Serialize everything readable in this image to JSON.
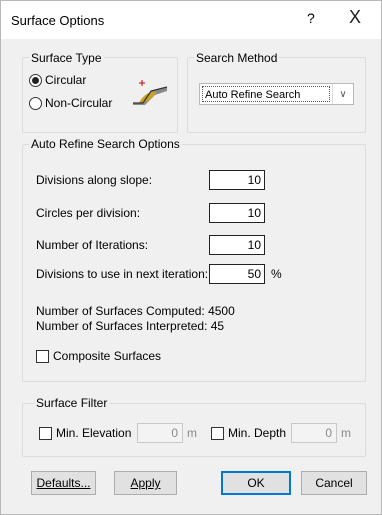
{
  "window": {
    "title": "Surface Options",
    "help_label": "?",
    "close_label": "X"
  },
  "surface_type": {
    "legend": "Surface Type",
    "options": [
      {
        "label": "Circular",
        "checked": true
      },
      {
        "label": "Non-Circular",
        "checked": false
      }
    ]
  },
  "search_method": {
    "legend": "Search Method",
    "selected": "Auto Refine Search"
  },
  "refine_options": {
    "legend": "Auto Refine Search Options",
    "fields": [
      {
        "label": "Divisions along slope:",
        "value": "10"
      },
      {
        "label": "Circles per division:",
        "value": "10"
      },
      {
        "label": "Number of Iterations:",
        "value": "10"
      },
      {
        "label": "Divisions to use in next iteration:",
        "value": "50"
      }
    ],
    "percent_unit": "%",
    "surfaces_computed": "Number of Surfaces Computed: 4500",
    "surfaces_interpreted": "Number of Surfaces Interpreted: 45",
    "composite_label": "Composite Surfaces"
  },
  "surface_filter": {
    "legend": "Surface Filter",
    "min_elevation": {
      "label": "Min. Elevation",
      "value": "0",
      "unit": "m"
    },
    "min_depth": {
      "label": "Min. Depth",
      "value": "0",
      "unit": "m"
    }
  },
  "buttons": {
    "defaults": "Defaults...",
    "apply": "Apply",
    "ok": "OK",
    "cancel": "Cancel"
  }
}
